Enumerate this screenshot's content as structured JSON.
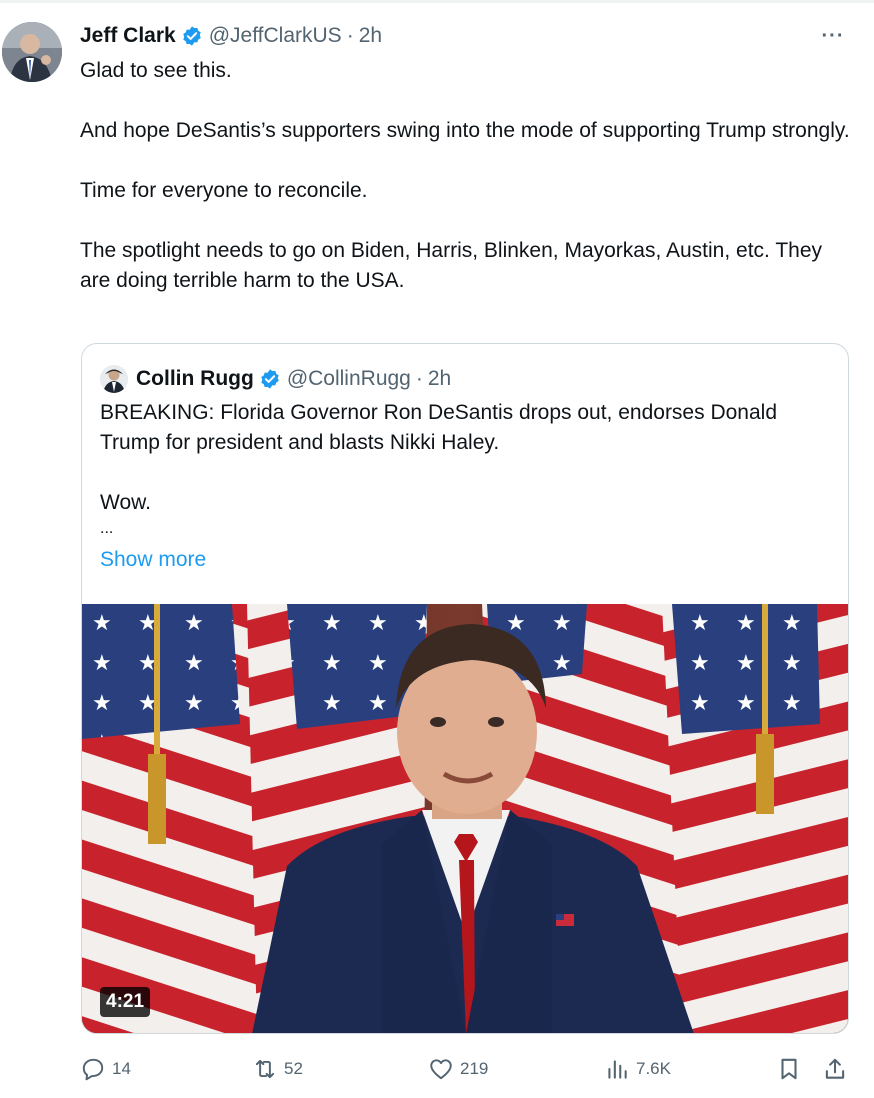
{
  "tweet": {
    "author_name": "Jeff Clark",
    "handle": "@JeffClarkUS",
    "separator": "·",
    "time": "2h",
    "more_label": "···",
    "paragraphs": [
      "Glad to see this.",
      "And hope DeSantis’s supporters swing into the mode of supporting Trump strongly.",
      "Time for everyone to reconcile.",
      "The spotlight needs to go on Biden, Harris, Blinken, Mayorkas, Austin, etc. They are doing terrible harm to the USA."
    ]
  },
  "quote": {
    "author_name": "Collin Rugg",
    "handle": "@CollinRugg",
    "separator": "·",
    "time": "2h",
    "text_line1": "BREAKING: Florida Governor Ron DeSantis drops out, endorses Donald Trump for president and blasts Nikki Haley.",
    "text_line2": "Wow.",
    "text_line3": "...",
    "show_more": "Show more",
    "video_duration": "4:21"
  },
  "actions": {
    "replies": "14",
    "reposts": "52",
    "likes": "219",
    "views": "7.6K"
  },
  "colors": {
    "accent": "#1d9bf0",
    "text": "#0f1419",
    "muted": "#536471",
    "border": "#cfd9de"
  },
  "icons": [
    "verified-badge-icon",
    "more-icon",
    "reply-icon",
    "retweet-icon",
    "like-icon",
    "views-icon",
    "bookmark-icon",
    "share-icon"
  ]
}
